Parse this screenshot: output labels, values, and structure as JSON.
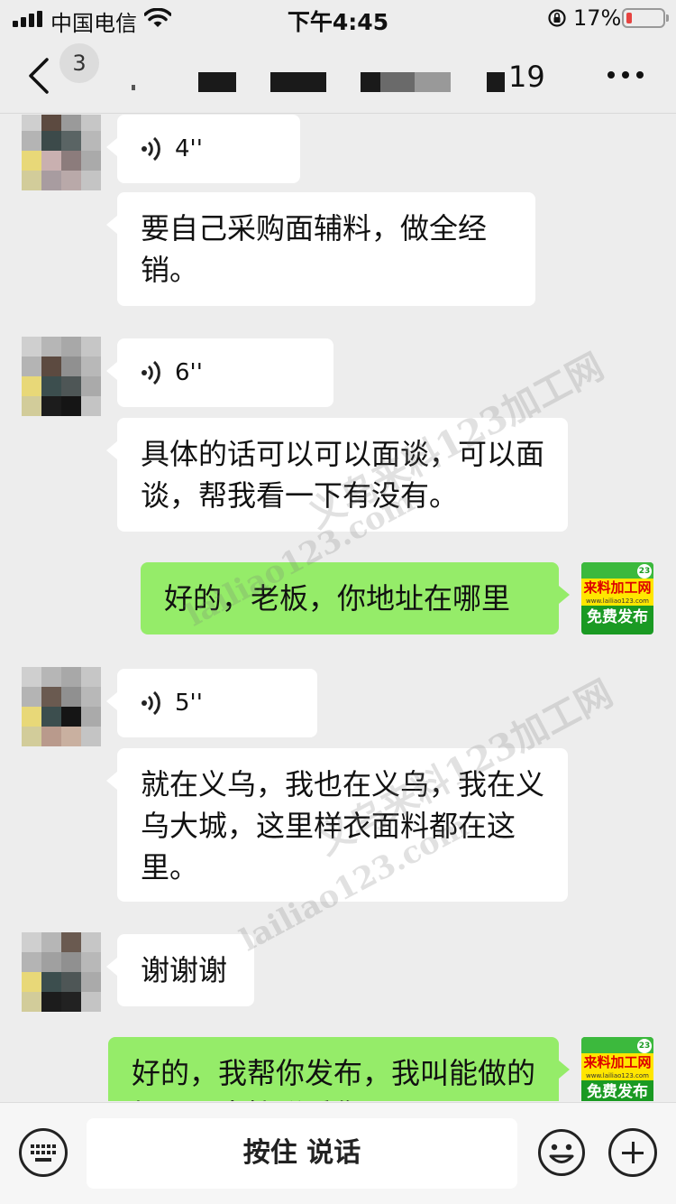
{
  "status_bar": {
    "carrier": "中国电信",
    "time": "下午4:45",
    "battery": "17%",
    "battery_level": 0.17
  },
  "nav": {
    "unread_count": "3",
    "title_suffix": "19"
  },
  "messages": [
    {
      "type": "voice",
      "from": "contact",
      "duration": "4''"
    },
    {
      "type": "text",
      "from": "contact",
      "text": "要自己采购面辅料，做全经销。"
    },
    {
      "type": "voice",
      "from": "contact",
      "duration": "6''"
    },
    {
      "type": "text",
      "from": "contact",
      "text": "具体的话可以可以面谈，可以面谈，帮我看一下有没有。"
    },
    {
      "type": "text",
      "from": "me",
      "text": "好的，老板，你地址在哪里"
    },
    {
      "type": "voice",
      "from": "contact",
      "duration": "5''"
    },
    {
      "type": "text",
      "from": "contact",
      "text": "就在义乌，我也在义乌，我在义乌大城，这里样衣面料都在这里。"
    },
    {
      "type": "text",
      "from": "contact",
      "text": "谢谢谢"
    },
    {
      "type": "text",
      "from": "me",
      "text": "好的，我帮你发布，我叫能做的加工厂直接联系你"
    }
  ],
  "my_avatar": {
    "title": "来料加工网",
    "url": "www.lailiao123.com",
    "subtitle": "免费发布",
    "badge": "23"
  },
  "watermark": {
    "cn": "义乌来料123加工网",
    "url": "lailiao123.com"
  },
  "input_bar": {
    "talk_label": "按住 说话"
  }
}
